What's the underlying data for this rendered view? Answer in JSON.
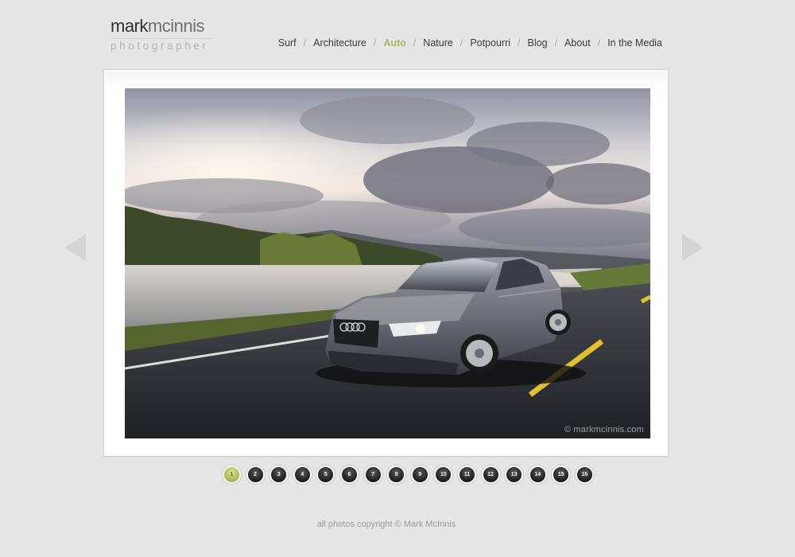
{
  "logo": {
    "first": "mark",
    "last": "mcinnis",
    "subtitle": "photographer"
  },
  "nav": {
    "items": [
      {
        "label": "Surf",
        "active": false
      },
      {
        "label": "Architecture",
        "active": false
      },
      {
        "label": "Auto",
        "active": true
      },
      {
        "label": "Nature",
        "active": false
      },
      {
        "label": "Potpourri",
        "active": false
      },
      {
        "label": "Blog",
        "active": false
      },
      {
        "label": "About",
        "active": false
      },
      {
        "label": "In the Media",
        "active": false
      }
    ],
    "separator": "/",
    "active_color": "#a9b85a"
  },
  "photo": {
    "subject": "silver sedan driving on a riverside road under a cloudy sky",
    "watermark": "© markmcinnis.com"
  },
  "arrows": {
    "prev_icon": "left-triangle-arrow-icon",
    "next_icon": "right-triangle-arrow-icon"
  },
  "pager": {
    "current": 1,
    "pages": [
      "1",
      "2",
      "3",
      "4",
      "5",
      "6",
      "7",
      "8",
      "9",
      "10",
      "11",
      "12",
      "13",
      "14",
      "15",
      "16"
    ]
  },
  "footer": {
    "text": "all photos copyright © Mark McInnis"
  }
}
